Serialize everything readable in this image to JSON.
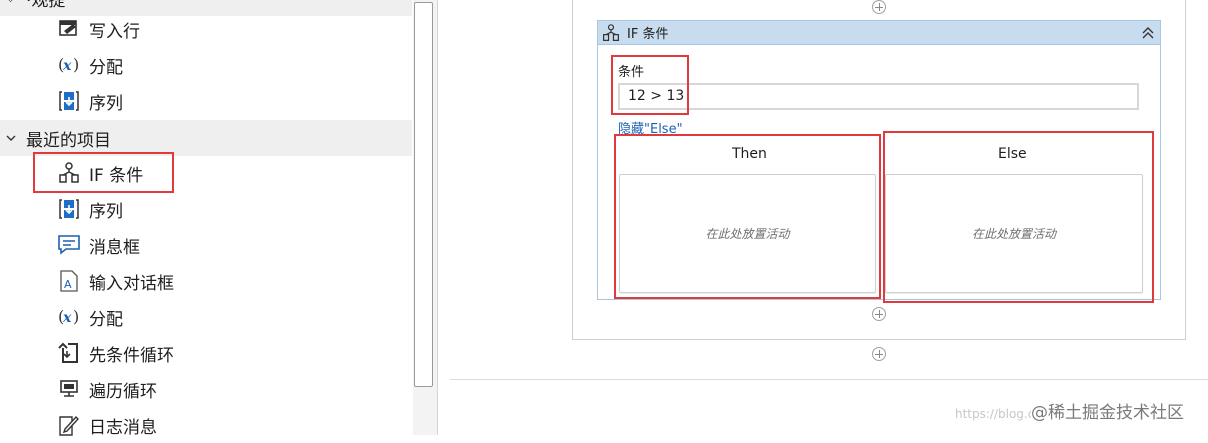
{
  "activities_panel": {
    "partial_group_label": "·观提",
    "items_top": [
      {
        "label": "写入行",
        "icon": "write-line-icon"
      },
      {
        "label": "分配",
        "icon": "assign-icon"
      },
      {
        "label": "序列",
        "icon": "sequence-icon"
      }
    ],
    "recent_group": {
      "label": "最近的项目",
      "expanded": true
    },
    "recent_items": [
      {
        "label": "IF 条件",
        "icon": "if-condition-icon"
      },
      {
        "label": "序列",
        "icon": "sequence-icon"
      },
      {
        "label": "消息框",
        "icon": "message-box-icon"
      },
      {
        "label": "输入对话框",
        "icon": "input-dialog-icon"
      },
      {
        "label": "分配",
        "icon": "assign-icon"
      },
      {
        "label": "先条件循环",
        "icon": "while-loop-icon"
      },
      {
        "label": "遍历循环",
        "icon": "for-each-icon"
      },
      {
        "label": "日志消息",
        "icon": "log-message-icon"
      }
    ]
  },
  "designer": {
    "if_activity": {
      "title": "IF 条件",
      "condition_label": "条件",
      "condition_value": "12 > 13",
      "hide_else_link": "隐藏\"Else\"",
      "then_label": "Then",
      "else_label": "Else",
      "drop_hint": "在此处放置活动"
    }
  },
  "watermark": {
    "prefix": "https://blog.csdn.net/weixin_4",
    "text": "@稀土掘金技术社区"
  },
  "colors": {
    "annotation_red": "#e03a3e",
    "if_header_blue": "#c8dcf0",
    "link_blue": "#1c61b8"
  }
}
